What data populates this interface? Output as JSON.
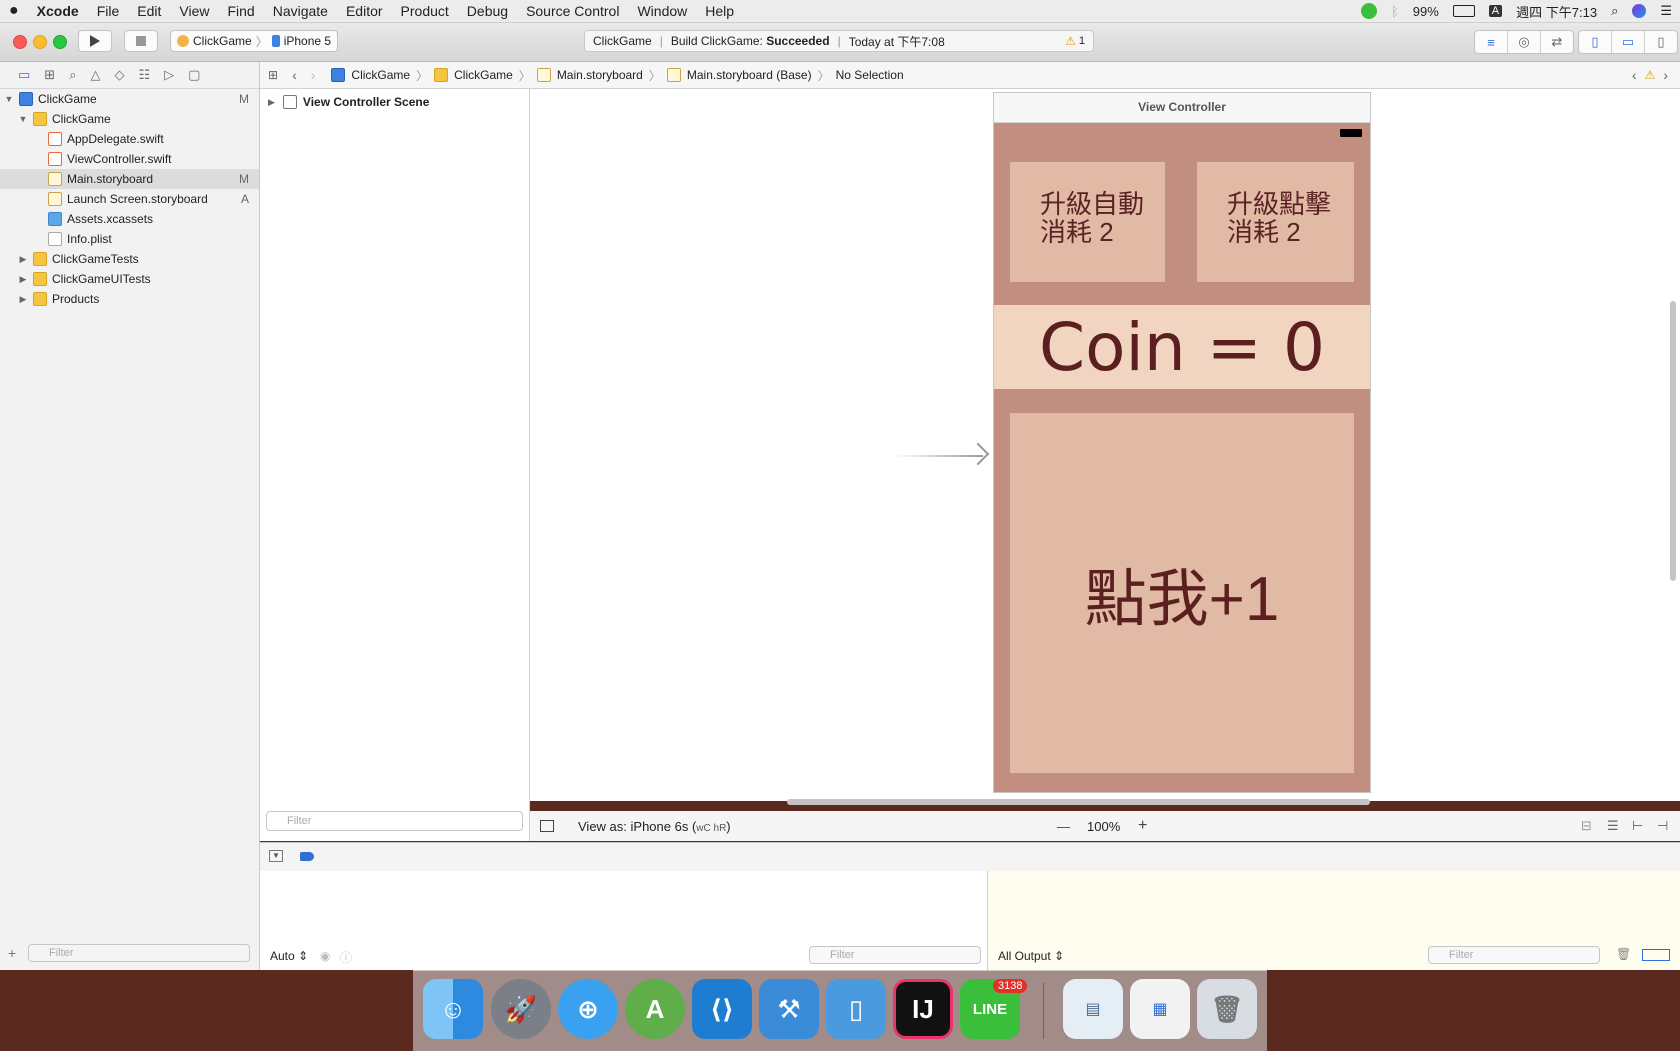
{
  "menubar": {
    "apple": "",
    "app": "Xcode",
    "items": [
      "File",
      "Edit",
      "View",
      "Find",
      "Navigate",
      "Editor",
      "Product",
      "Debug",
      "Source Control",
      "Window",
      "Help"
    ],
    "battery": "99%",
    "input_source": "A",
    "clock": "週四 下午7:13"
  },
  "toolbar": {
    "scheme": "ClickGame",
    "device": "iPhone 5",
    "activity_project": "ClickGame",
    "activity_build_prefix": "Build ClickGame:",
    "activity_build_status": "Succeeded",
    "activity_time": "Today at 下午7:08",
    "warning_count": "1"
  },
  "navigator": {
    "tree": [
      {
        "label": "ClickGame",
        "badge": "M"
      },
      {
        "label": "ClickGame",
        "badge": ""
      },
      {
        "label": "AppDelegate.swift",
        "badge": ""
      },
      {
        "label": "ViewController.swift",
        "badge": ""
      },
      {
        "label": "Main.storyboard",
        "badge": "M"
      },
      {
        "label": "Launch Screen.storyboard",
        "badge": "A"
      },
      {
        "label": "Assets.xcassets",
        "badge": ""
      },
      {
        "label": "Info.plist",
        "badge": ""
      },
      {
        "label": "ClickGameTests",
        "badge": ""
      },
      {
        "label": "ClickGameUITests",
        "badge": ""
      },
      {
        "label": "Products",
        "badge": ""
      }
    ],
    "filter_placeholder": "Filter"
  },
  "jumpbar": {
    "crumbs": [
      "ClickGame",
      "ClickGame",
      "Main.storyboard",
      "Main.storyboard (Base)",
      "No Selection"
    ]
  },
  "outline": {
    "scene": "View Controller Scene",
    "filter_placeholder": "Filter"
  },
  "canvas": {
    "vc_title": "View Controller",
    "upgrade_auto": [
      "升級自動",
      "消耗 2"
    ],
    "upgrade_click": [
      "升級點擊",
      "消耗 2"
    ],
    "coin_label": "Coin = 0",
    "tap_button": "點我+1",
    "view_as": "View as: iPhone 6s (",
    "size_class": "wC hR",
    "view_as_end": ")",
    "zoom": "100%",
    "zoom_minus": "—",
    "zoom_plus": "+"
  },
  "debug": {
    "auto": "Auto",
    "output": "All Output",
    "filter_placeholder": "Filter"
  },
  "dock": {
    "line_badge": "3138"
  },
  "colors": {
    "screen_bg": "#c28e80",
    "button_bg": "#e1baa6",
    "coin_bg": "#f2d5c0",
    "text": "#5b1f20",
    "accent": "#2f6fd6"
  }
}
